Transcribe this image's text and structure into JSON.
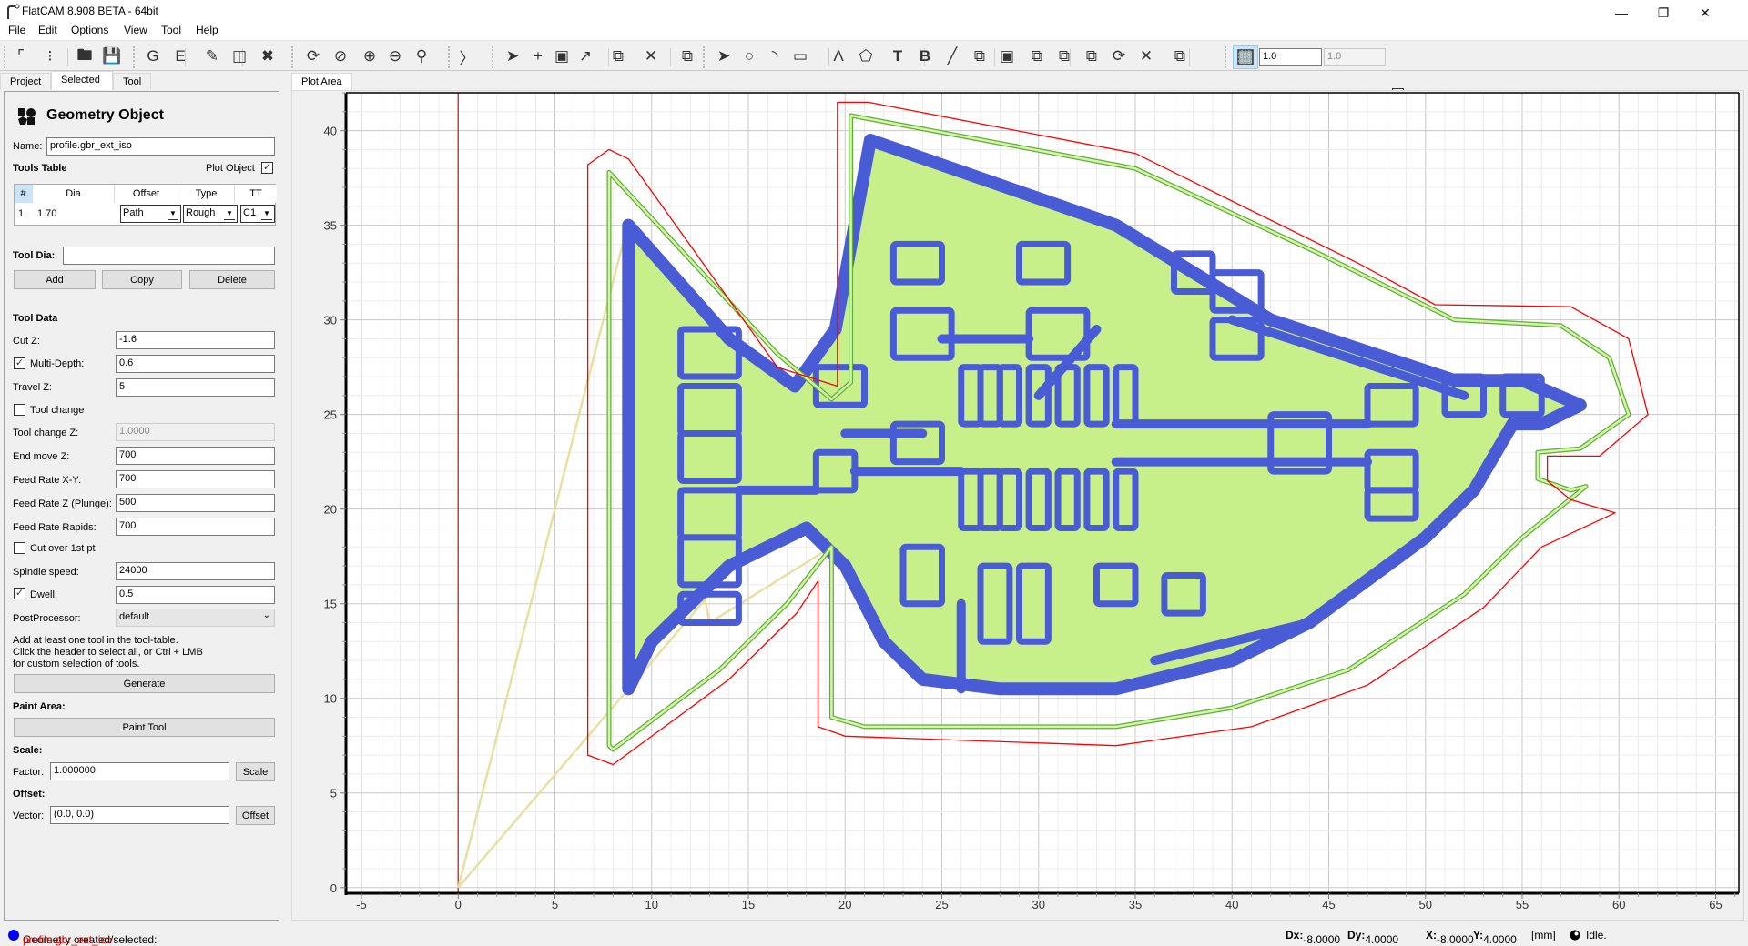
{
  "window": {
    "title": "FlatCAM 8.908 BETA - 64bit",
    "controls": [
      "minimize",
      "restore",
      "close"
    ]
  },
  "menu": [
    "File",
    "Edit",
    "Options",
    "View",
    "Tool",
    "Help"
  ],
  "toolbar": {
    "icons": [
      "replot-icon",
      "clear-plot-icon",
      "open-folder-icon",
      "save-icon",
      "new-gerber-icon",
      "new-excellon-icon",
      "edit-icon",
      "edit-disabled-icon",
      "delete-file-icon",
      "replot-all-icon",
      "clear-plot-all-icon",
      "zoom-in-icon",
      "zoom-out-icon",
      "zoom-fit-icon",
      "shell-icon",
      "select-icon",
      "add-icon",
      "resize-icon",
      "transform-icon",
      "copy-shape-icon",
      "delete-shape-icon",
      "move-icon",
      "pointer-icon",
      "circle-icon",
      "arc-icon",
      "rectangle-icon",
      "path-icon",
      "polygon-icon",
      "text-icon",
      "buffer-icon",
      "paint-icon",
      "union-icon",
      "intersection-icon",
      "subtract-icon",
      "cut-icon",
      "copy-icon",
      "rotate-icon",
      "delete-icon",
      "move-objects-icon",
      "snap-grid-icon"
    ],
    "grid_x": "1.0",
    "grid_y": "1.0",
    "grid_lock_checked": true
  },
  "left_tabs": [
    {
      "label": "Project",
      "active": false
    },
    {
      "label": "Selected",
      "active": true
    },
    {
      "label": "Tool",
      "active": false
    }
  ],
  "panel": {
    "header": "Geometry Object",
    "name_label": "Name:",
    "name_value": "profile.gbr_ext_iso",
    "tools_table_label": "Tools Table",
    "plot_object_label": "Plot Object",
    "plot_object_checked": true,
    "table": {
      "columns": [
        "#",
        "Dia",
        "Offset",
        "Type",
        "TT"
      ],
      "rows": [
        {
          "num": "1",
          "dia": "1.70",
          "offset": "Path",
          "type": "Rough",
          "tt": "C1"
        }
      ]
    },
    "tool_dia_label": "Tool Dia:",
    "tool_dia_value": "",
    "add_label": "Add",
    "copy_label": "Copy",
    "delete_label": "Delete",
    "tool_data_label": "Tool Data",
    "fields": {
      "cut_z": {
        "label": "Cut Z:",
        "value": "-1.6"
      },
      "multi_depth": {
        "label": "Multi-Depth:",
        "value": "0.6",
        "checked": true
      },
      "travel_z": {
        "label": "Travel Z:",
        "value": "5"
      },
      "tool_change": {
        "label": "Tool change",
        "checked": false
      },
      "tool_change_z": {
        "label": "Tool change Z:",
        "value": "1.0000"
      },
      "end_move_z": {
        "label": "End move Z:",
        "value": "700"
      },
      "feed_xy": {
        "label": "Feed Rate X-Y:",
        "value": "700"
      },
      "feed_z": {
        "label": "Feed Rate Z (Plunge):",
        "value": "500"
      },
      "feed_rapids": {
        "label": "Feed Rate Rapids:",
        "value": "700"
      },
      "cut_over": {
        "label": "Cut over 1st pt",
        "checked": false
      },
      "spindle": {
        "label": "Spindle speed:",
        "value": "24000"
      },
      "dwell": {
        "label": "Dwell:",
        "value": "0.5",
        "checked": true
      },
      "postprocessor": {
        "label": "PostProcessor:",
        "value": "default"
      }
    },
    "hint_lines": [
      "Add at least one tool in the tool-table.",
      "Click the header to select all, or Ctrl + LMB",
      "for custom selection of tools."
    ],
    "generate_label": "Generate",
    "paint_area_label": "Paint Area:",
    "paint_tool_label": "Paint Tool",
    "scale_label": "Scale:",
    "factor_label": "Factor:",
    "factor_value": "1.000000",
    "scale_button": "Scale",
    "offset_label": "Offset:",
    "vector_label": "Vector:",
    "vector_value": "(0.0, 0.0)",
    "offset_button": "Offset"
  },
  "plot": {
    "tab_label": "Plot Area",
    "x_ticks": [
      "-5",
      "0",
      "5",
      "10",
      "15",
      "20",
      "25",
      "30",
      "35",
      "40",
      "45",
      "50",
      "55",
      "60",
      "65"
    ],
    "y_ticks": [
      "0",
      "5",
      "10",
      "15",
      "20",
      "25",
      "30",
      "35",
      "40"
    ],
    "x_range": [
      -5.8,
      66.2
    ],
    "y_range": [
      -0.3,
      42
    ],
    "colors": {
      "isolation": "#4a5bd6",
      "copper_fill": "#c8f08a",
      "outline_ext": "#5fae3a",
      "outline_red": "#ff0000",
      "travel": "#e6dd9a",
      "axis_y": "#c04040"
    }
  },
  "status": {
    "message_prefix": "Geometry created/selected: ",
    "message_object": "profile.gbr_ext_iso",
    "dx_label": "Dx:",
    "dx_value": "-8.0000",
    "dy_label": "Dy:",
    "dy_value": "4.0000",
    "x_label": "X:",
    "x_value": "-8.0000",
    "y_label": "Y:",
    "y_value": "4.0000",
    "units": "[mm]",
    "state": "Idle."
  }
}
